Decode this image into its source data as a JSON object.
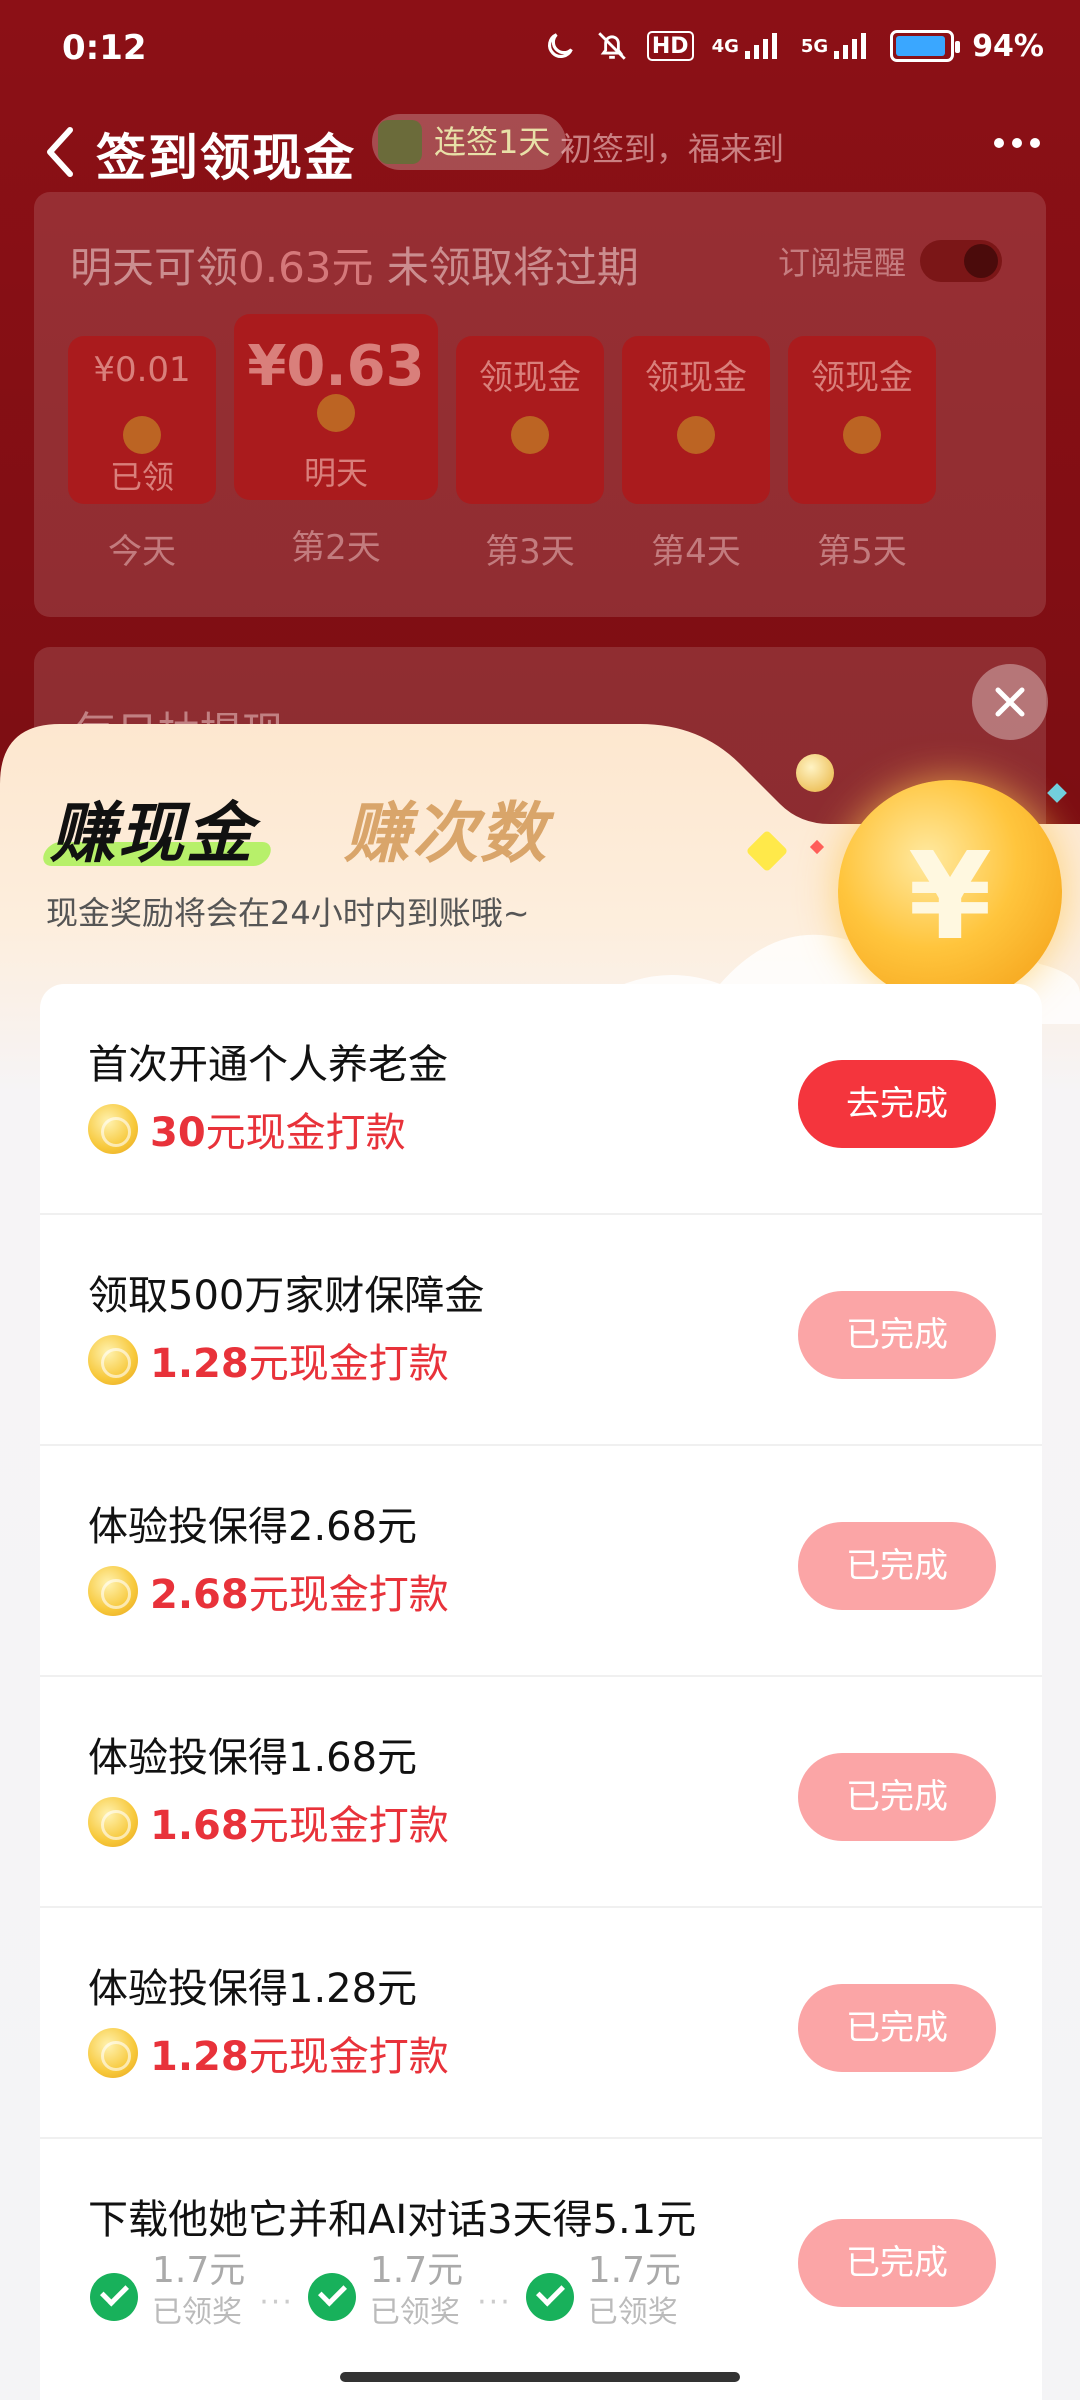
{
  "status_bar": {
    "time": "0:12",
    "network1": "HD",
    "network2": "4G",
    "network3": "5G",
    "battery": "94%",
    "battery_level": 0.94
  },
  "header": {
    "title": "签到领现金",
    "streak_badge": "连签1天",
    "subtitle": "初签到，福来到"
  },
  "signin_card": {
    "tomorrow_prefix": "明天可领",
    "tomorrow_amount": "0.63元",
    "tomorrow_suffix": " 未领取将过期",
    "reminder_label": "订阅提醒",
    "days": [
      {
        "top": "¥0.01",
        "sub": "已领",
        "label": "今天"
      },
      {
        "top": "¥0.63",
        "sub": "明天",
        "label": "第2天"
      },
      {
        "top": "领现金",
        "sub": "",
        "label": "第3天"
      },
      {
        "top": "领现金",
        "sub": "",
        "label": "第4天"
      },
      {
        "top": "领现金",
        "sub": "",
        "label": "第5天"
      }
    ]
  },
  "card2": {
    "label": "每日抽提现"
  },
  "sheet": {
    "tab_cash": "赚现金",
    "tab_times": "赚次数",
    "tagline": "现金奖励将会在24小时内到账哦~",
    "coin_symbol": "¥",
    "tasks": [
      {
        "title": "首次开通个人养老金",
        "amount": "30",
        "suffix": "元现金打款",
        "button": "去完成"
      },
      {
        "title": "领取500万家财保障金",
        "amount": "1.28",
        "suffix": "元现金打款",
        "button": "已完成"
      },
      {
        "title": "体验投保得2.68元",
        "amount": "2.68",
        "suffix": "元现金打款",
        "button": "已完成"
      },
      {
        "title": "体验投保得1.68元",
        "amount": "1.68",
        "suffix": "元现金打款",
        "button": "已完成"
      },
      {
        "title": "体验投保得1.28元",
        "amount": "1.28",
        "suffix": "元现金打款",
        "button": "已完成"
      }
    ],
    "last_task": {
      "title": "下载他她它并和AI对话3天得5.1元",
      "button": "已完成",
      "steps": [
        {
          "amount": "1.7元",
          "status": "已领奖"
        },
        {
          "amount": "1.7元",
          "status": "已领奖"
        },
        {
          "amount": "1.7元",
          "status": "已领奖"
        }
      ]
    }
  }
}
